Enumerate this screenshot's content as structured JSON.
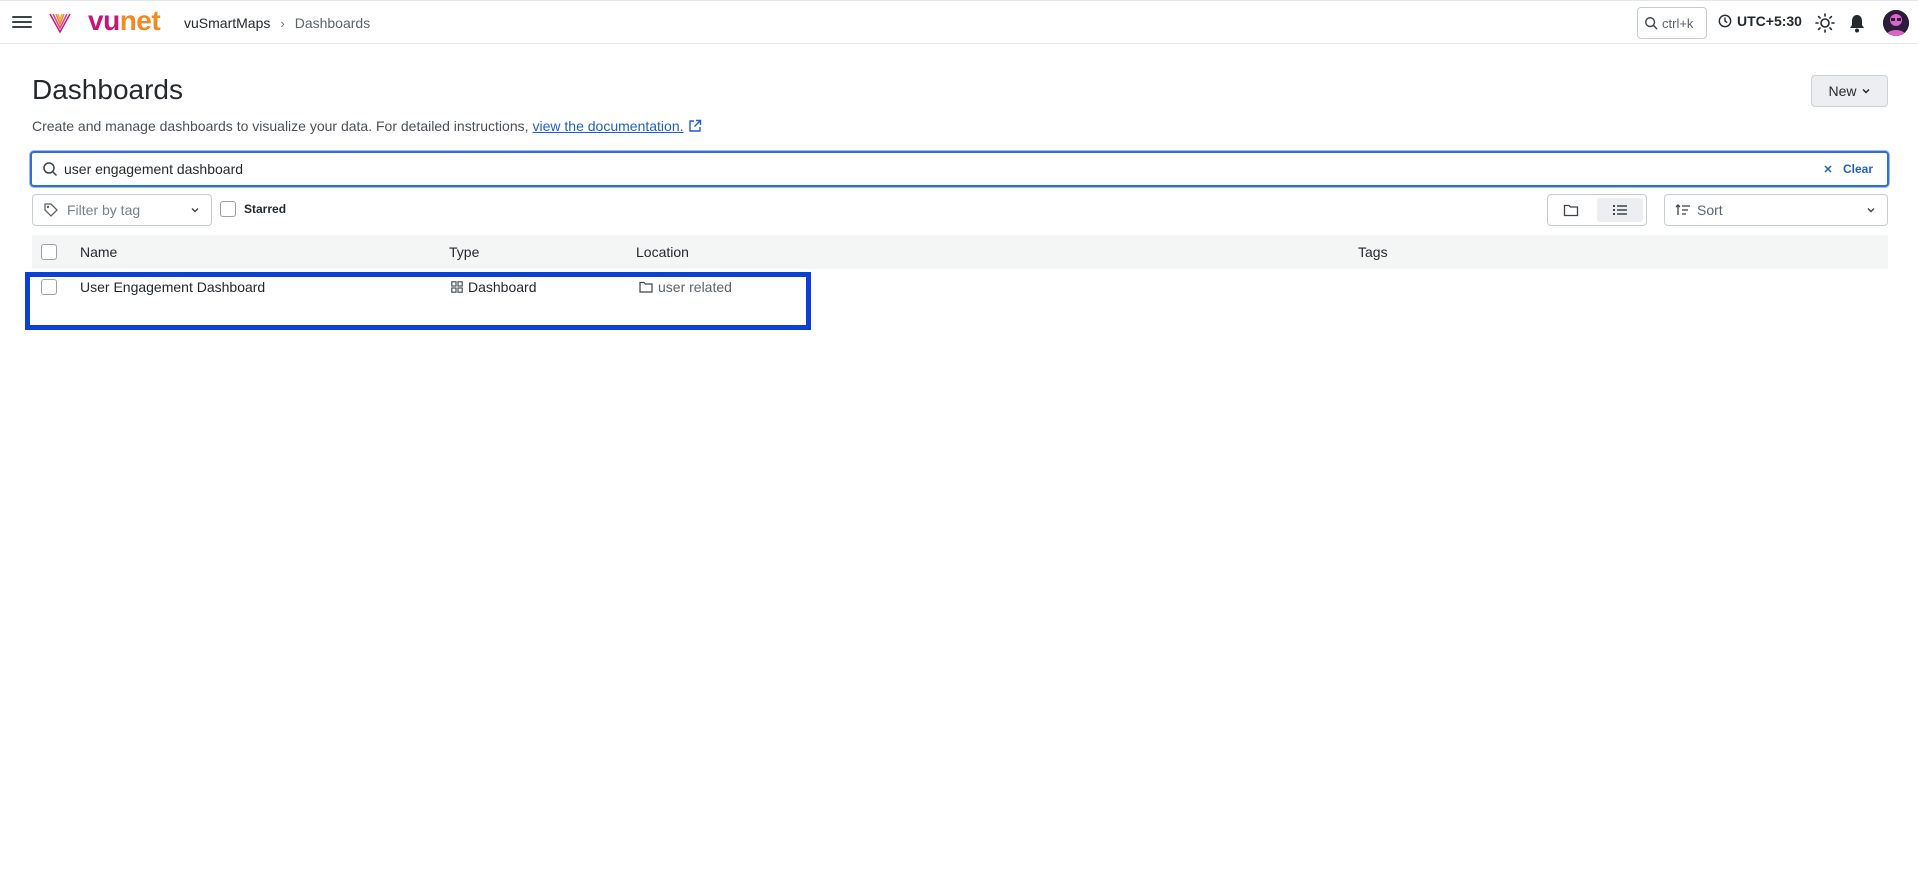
{
  "topbar": {
    "logo_vu": "vu",
    "logo_net": "net",
    "breadcrumb": [
      "vuSmartMaps",
      "Dashboards"
    ],
    "breadcrumb_separator": "›",
    "search_shortcut": "ctrl+k",
    "timezone": "UTC+5:30"
  },
  "page": {
    "title": "Dashboards",
    "description": "Create and manage dashboards to visualize your data. For detailed instructions,",
    "doc_link": "view the documentation.",
    "new_button": "New"
  },
  "search": {
    "value": "user engagement dashboard",
    "clear_label": "Clear"
  },
  "filters": {
    "tag_placeholder": "Filter by tag",
    "starred_label": "Starred",
    "sort_label": "Sort"
  },
  "table": {
    "columns": [
      "Name",
      "Type",
      "Location",
      "Tags"
    ],
    "rows": [
      {
        "name": "User Engagement Dashboard",
        "type": "Dashboard",
        "location": "user related",
        "tags": ""
      }
    ]
  },
  "colors": {
    "brand_vu": "#c4177a",
    "brand_net": "#f08a24",
    "link": "#1f5fcc",
    "highlight_box": "#0b3fd8"
  }
}
